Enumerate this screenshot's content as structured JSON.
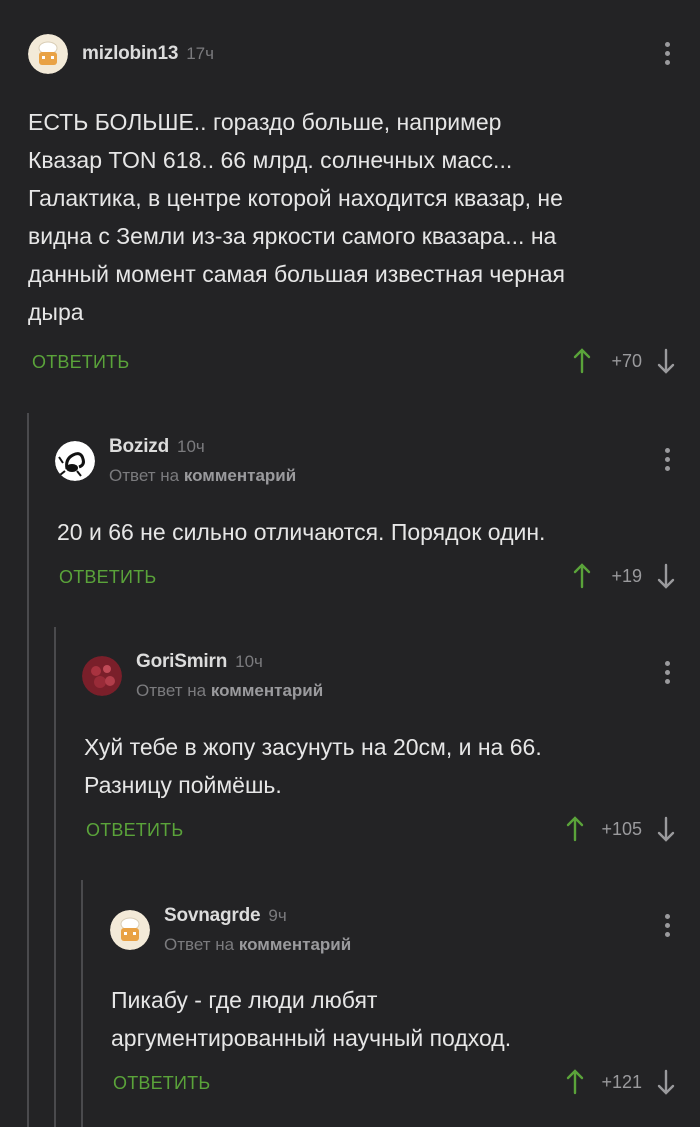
{
  "comments": [
    {
      "username": "mizlobin13",
      "time": "17ч",
      "reply_prefix": "",
      "reply_target": "",
      "text_lines": [
        "ЕСТЬ БОЛЬШЕ.. гораздо больше, например",
        "Квазар TON 618.. 66 млрд. солнечных масс...",
        "Галактика, в центре которой находится квазар, не",
        "видна с Земли из-за яркости самого квазара... на",
        "данный момент самая большая известная черная",
        "дыра"
      ],
      "reply_label": "ОТВЕТИТЬ",
      "rating": "+70"
    },
    {
      "username": "Bozizd",
      "time": "10ч",
      "reply_prefix": "Ответ на",
      "reply_target": "комментарий",
      "text_lines": [
        "20 и 66 не сильно отличаются. Порядок один."
      ],
      "reply_label": "ОТВЕТИТЬ",
      "rating": "+19"
    },
    {
      "username": "GoriSmirn",
      "time": "10ч",
      "reply_prefix": "Ответ на",
      "reply_target": "комментарий",
      "text_lines": [
        "Хуй тебе в жопу засунуть на 20см, и на 66.",
        "Разницу поймёшь."
      ],
      "reply_label": "ОТВЕТИТЬ",
      "rating": "+105"
    },
    {
      "username": "Sovnagrde",
      "time": "9ч",
      "reply_prefix": "Ответ на",
      "reply_target": "комментарий",
      "text_lines": [
        "Пикабу - где люди любят",
        "аргументированный научный подход."
      ],
      "reply_label": "ОТВЕТИТЬ",
      "rating": "+121"
    }
  ],
  "colors": {
    "background": "#232325",
    "accent_green": "#5aa33a",
    "muted": "#7b7b7e"
  },
  "icons": [
    "more-vertical-icon",
    "upvote-arrow-icon",
    "downvote-arrow-icon",
    "chef-avatar",
    "scorpion-avatar",
    "meat-avatar"
  ]
}
